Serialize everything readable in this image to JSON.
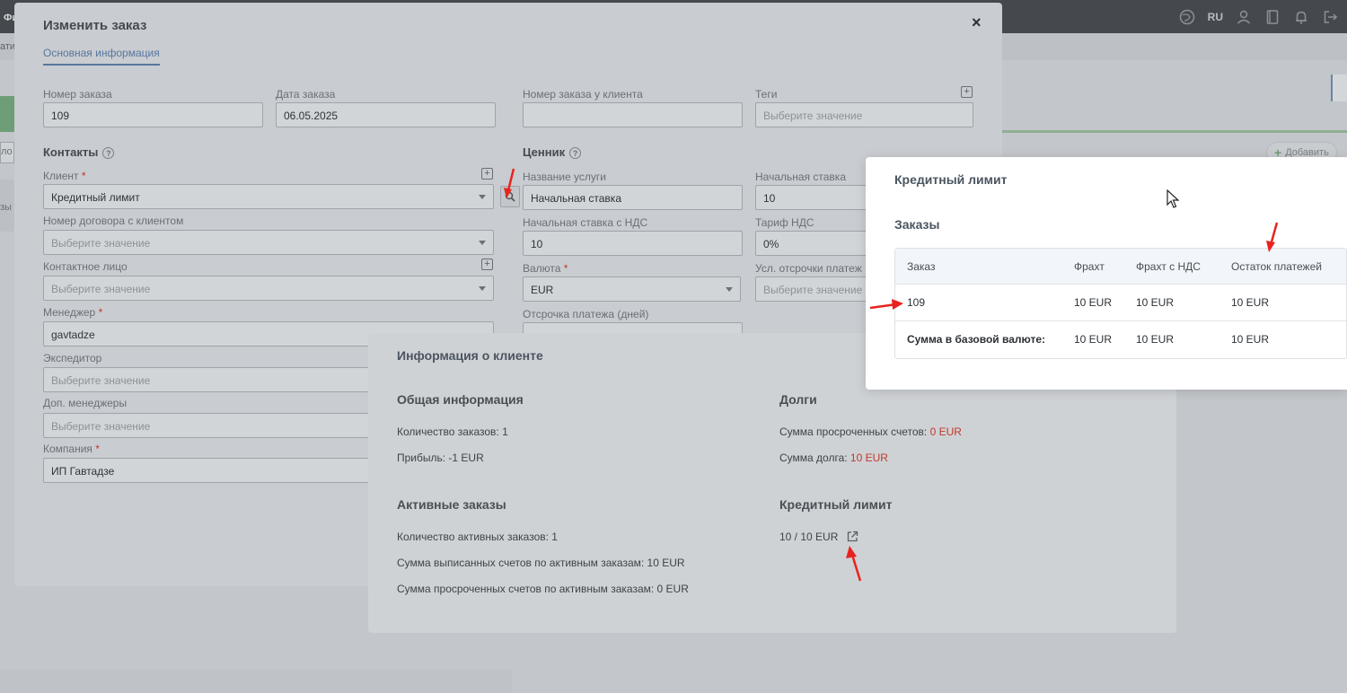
{
  "topbar": {
    "left_text": "Фи",
    "lang": "RU"
  },
  "subbar": {
    "text": "ати"
  },
  "background": {
    "add_button": "Добавить",
    "left_input_text": "ло",
    "left_text": "зы"
  },
  "order_modal": {
    "title": "Изменить заказ",
    "close": "×",
    "tab": "Основная информация",
    "fields": {
      "order_number": {
        "label": "Номер заказа",
        "value": "109"
      },
      "order_date": {
        "label": "Дата заказа",
        "value": "06.05.2025"
      },
      "client_order_number": {
        "label": "Номер заказа у клиента",
        "value": ""
      },
      "tags": {
        "label": "Теги",
        "placeholder": "Выберите значение"
      },
      "client": {
        "label": "Клиент",
        "value": "Кредитный лимит"
      },
      "contract": {
        "label": "Номер договора с клиентом",
        "placeholder": "Выберите значение"
      },
      "contact": {
        "label": "Контактное лицо",
        "placeholder": "Выберите значение"
      },
      "manager": {
        "label": "Менеджер",
        "value": "gavtadze"
      },
      "forwarder": {
        "label": "Экспедитор",
        "placeholder": "Выберите значение"
      },
      "extra_managers": {
        "label": "Доп. менеджеры",
        "placeholder": "Выберите значение"
      },
      "company": {
        "label": "Компания",
        "value": "ИП Гавтадзе"
      },
      "service_name": {
        "label": "Название услуги",
        "value": "Начальная ставка"
      },
      "initial_rate": {
        "label": "Начальная ставка",
        "value": "10"
      },
      "initial_rate_vat": {
        "label": "Начальная ставка с НДС",
        "value": "10"
      },
      "vat_rate": {
        "label": "Тариф НДС",
        "value": "0%"
      },
      "currency": {
        "label": "Валюта",
        "value": "EUR"
      },
      "payment_terms": {
        "label": "Усл. отсрочки платеж",
        "placeholder": "Выберите значение"
      },
      "payment_delay": {
        "label": "Отсрочка платежа (дней)"
      }
    },
    "sections": {
      "contacts": "Контакты",
      "pricing": "Ценник"
    },
    "required_mark": "*",
    "help_mark": "?"
  },
  "client_modal": {
    "title": "Информация о клиенте",
    "general": {
      "heading": "Общая информация",
      "orders_count": "Количество заказов: 1",
      "profit": "Прибыль: -1 EUR"
    },
    "debts": {
      "heading": "Долги",
      "overdue_label": "Сумма просроченных счетов: ",
      "overdue_value": "0 EUR",
      "debt_label": "Сумма долга: ",
      "debt_value": "10 EUR"
    },
    "active": {
      "heading": "Активные заказы",
      "count": "Количество активных заказов: 1",
      "invoiced": "Сумма выписанных счетов по активным заказам: 10 EUR",
      "overdue": "Сумма просроченных счетов по активным заказам: 0 EUR"
    },
    "credit": {
      "heading": "Кредитный лимит",
      "value": "10 / 10 EUR"
    }
  },
  "credit_modal": {
    "title": "Кредитный лимит",
    "orders_heading": "Заказы",
    "table": {
      "headers": [
        "Заказ",
        "Фрахт",
        "Фрахт с НДС",
        "Остаток платежей"
      ],
      "rows": [
        [
          "109",
          "10 EUR",
          "10 EUR",
          "10 EUR"
        ]
      ],
      "sum_row": [
        "Сумма в базовой валюте:",
        "10 EUR",
        "10 EUR",
        "10 EUR"
      ]
    }
  },
  "colors": {
    "accent": "#5876a0",
    "required": "#c0392b",
    "annotation_arrow": "#e8231f"
  }
}
